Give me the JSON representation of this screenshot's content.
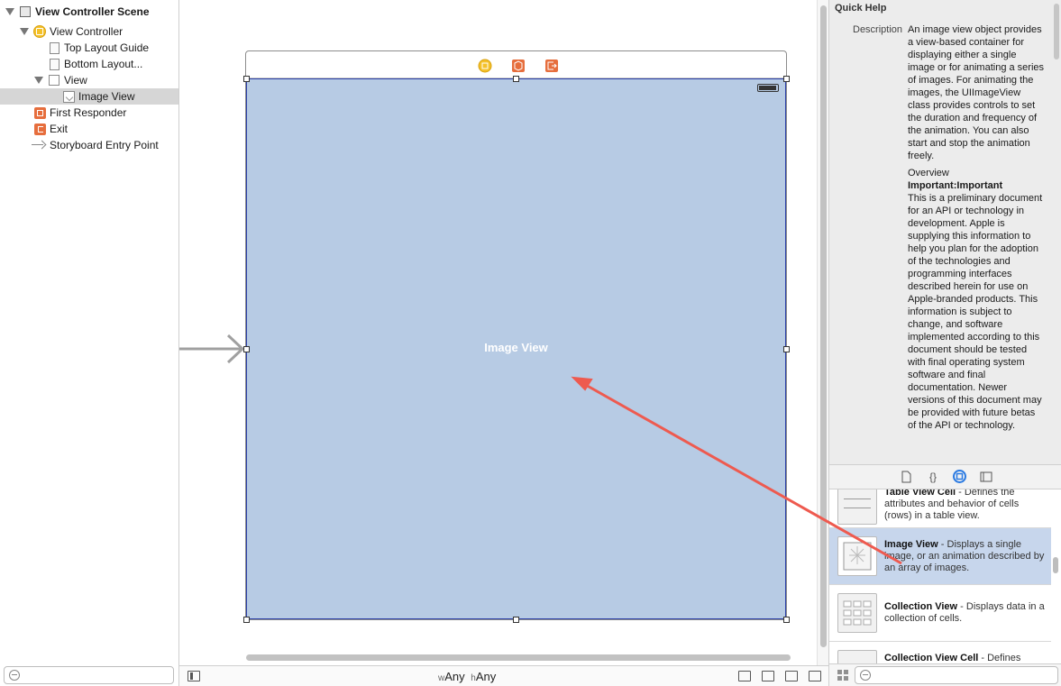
{
  "outline": {
    "items": [
      {
        "label": "View Controller Scene"
      },
      {
        "label": "View Controller"
      },
      {
        "label": "Top Layout Guide"
      },
      {
        "label": "Bottom Layout..."
      },
      {
        "label": "View"
      },
      {
        "label": "Image View"
      },
      {
        "label": "First Responder"
      },
      {
        "label": "Exit"
      },
      {
        "label": "Storyboard Entry Point"
      }
    ],
    "filter_placeholder": ""
  },
  "canvas": {
    "image_view_label": "Image View",
    "size_class": {
      "w_prefix": "w",
      "w_value": "Any",
      "h_prefix": "h",
      "h_value": "Any"
    }
  },
  "inspector": {
    "quick_help_title": "Quick Help",
    "description_key": "Description",
    "description": "An image view object provides a view-based container for displaying either a single image or for animating a series of images. For animating the images, the UIImageView class provides controls to set the duration and frequency of the animation. You can also start and stop the animation freely.",
    "overview_heading": "Overview",
    "important": "Important:Important",
    "overview_body": "This is a preliminary document for an API or technology in development. Apple is supplying this information to help you plan for the adoption of the technologies and programming interfaces described herein for use on Apple-branded products. This information is subject to change, and software implemented according to this document should be tested with final operating system software and final documentation. Newer versions of this document may be provided with future betas of the API or technology.",
    "library_tabs": [
      "file-template-icon",
      "code-snippet-icon",
      "object-library-icon",
      "media-library-icon"
    ],
    "library_items": [
      {
        "title": "Table View Cell",
        "desc": " - Defines the attributes and behavior of cells (rows) in a table view."
      },
      {
        "title": "Image View",
        "desc": " - Displays a single image, or an animation described by an array of images."
      },
      {
        "title": "Collection View",
        "desc": " - Displays data in a collection of cells."
      },
      {
        "title": "Collection View Cell",
        "desc": " - Defines"
      }
    ],
    "filter_placeholder": ""
  },
  "colors": {
    "image_view_fill": "#b7cbe4",
    "selection_border": "#2b3fa8",
    "drag_arrow": "#ee5a4f",
    "accent": "#2a7ae2"
  }
}
